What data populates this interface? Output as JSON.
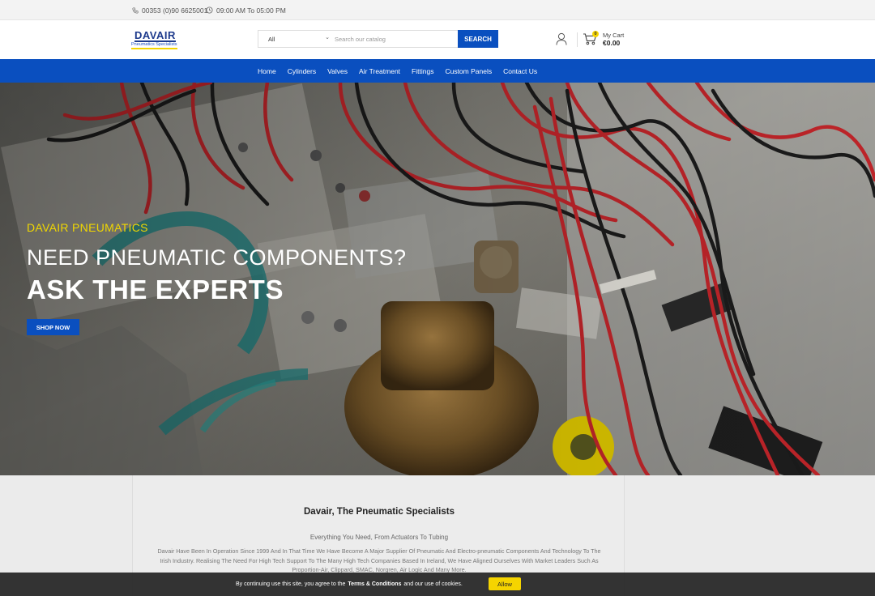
{
  "topbar": {
    "phone": "00353 (0)90 6625001",
    "hours": "09:00 AM To 05:00 PM",
    "phone_icon": "phone-icon",
    "clock_icon": "clock-icon"
  },
  "header": {
    "logo_name": "DAVAIR",
    "logo_tagline": "Pneumatics Specialists",
    "search": {
      "category": "All",
      "placeholder": "Search our catalog",
      "button": "SEARCH"
    },
    "user_icon": "user-icon",
    "cart": {
      "icon": "cart-icon",
      "count": "0",
      "label": "My Cart",
      "total": "€0.00"
    }
  },
  "nav": {
    "items": [
      "Home",
      "Cylinders",
      "Valves",
      "Air Treatment",
      "Fittings",
      "Custom Panels",
      "Contact Us"
    ]
  },
  "hero": {
    "eyebrow": "DAVAIR PNEUMATICS",
    "headline": "NEED PNEUMATIC COMPONENTS?",
    "headline2": "ASK THE EXPERTS",
    "cta": "SHOP NOW"
  },
  "intro": {
    "title": "Davair, The Pneumatic Specialists",
    "subtitle": "Everything You Need, From Actuators To Tubing",
    "body": "Davair Have Been In Operation Since 1999 And In That Time We Have Become A Major Supplier Of Pneumatic And Electro-pneumatic Components And Technology To The Irish Industry. Realising The Need For High Tech Support To The Many High Tech Companies Based In Ireland, We Have Aligned Ourselves With Market Leaders Such As Proportion-Air, Clippard, SMAC, Norgren, Air Logic And Many More."
  },
  "cookie": {
    "text_before": "By continuing use this site, you agree to the",
    "link": "Terms & Conditions",
    "text_after": "and our use of cookies.",
    "button": "Allow"
  },
  "colors": {
    "brand_blue": "#0a4fbf",
    "accent_yellow": "#f5d400"
  }
}
